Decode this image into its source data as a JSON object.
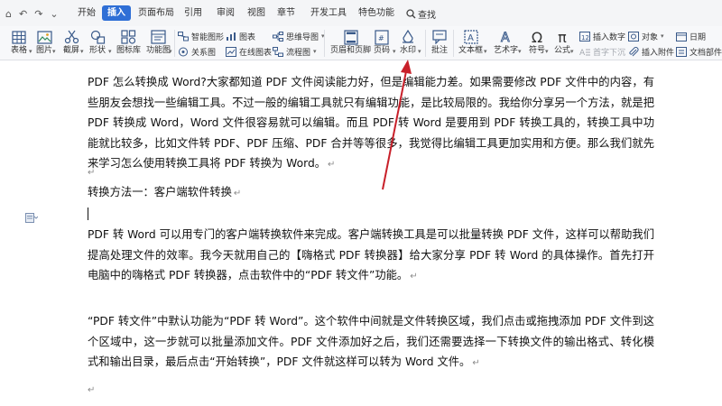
{
  "menu": {
    "quick_access": [
      "⌂",
      "↶",
      "↷",
      "⌄"
    ],
    "tabs": [
      {
        "label": "开始"
      },
      {
        "label": "插入"
      },
      {
        "label": "页面布局"
      },
      {
        "label": "引用"
      },
      {
        "label": "审阅"
      },
      {
        "label": "视图"
      },
      {
        "label": "章节"
      },
      {
        "label": "开发工具"
      },
      {
        "label": "特色功能"
      }
    ],
    "search_label": "查找"
  },
  "ribbon": {
    "table": "表格",
    "picture": "图片",
    "screenshot": "截屏",
    "shape": "形状",
    "icon_library": "图标库",
    "function_chart": "功能图",
    "smart_graphic": "智能图形",
    "chart": "图表",
    "mind_map": "思维导图",
    "relation_chart": "关系图",
    "online_chart": "在线图表",
    "flow_chart": "流程图",
    "header_footer": "页眉和页脚",
    "page_number": "页码",
    "watermark": "水印",
    "comment": "批注",
    "text_box": "文本框",
    "word_art": "艺术字",
    "symbol": "符号",
    "formula": "公式",
    "insert_number": "插入数字",
    "object": "对象",
    "date": "日期",
    "drop_cap": "首字下沉",
    "attachment": "插入附件",
    "doc_part": "文档部件"
  },
  "document": {
    "p1": "PDF 怎么转换成 Word?大家都知道 PDF 文件阅读能力好，但是编辑能力差。如果需要修改 PDF 文件中的内容，有些朋友会想找一些编辑工具。不过一般的编辑工具就只有编辑功能，是比较局限的。我给你分享另一个方法，就是把 PDF 转换成 Word，Word 文件很容易就可以编辑。而且 PDF 转 Word 是要用到 PDF 转换工具的，转换工具中功能就比较多，比如文件转 PDF、PDF 压缩、PDF 合并等等很多，我觉得比编辑工具更加实用和方便。那么我们就先来学习怎么使用转换工具将 PDF 转换为 Word。",
    "heading": "转换方法一：客户端软件转换",
    "p2": "PDF 转 Word 可以用专门的客户端转换软件来完成。客户端转换工具是可以批量转换 PDF 文件，这样可以帮助我们提高处理文件的效率。我今天就用自己的【嗨格式 PDF 转换器】给大家分享 PDF 转 Word 的具体操作。首先打开电脑中的嗨格式 PDF 转换器，点击软件中的“PDF 转文件”功能。",
    "p3": "“PDF 转文件”中默认功能为“PDF 转 Word”。这个软件中间就是文件转换区域，我们点击或拖拽添加 PDF 文件到这个区域中，这一步就可以批量添加文件。PDF 文件添加好之后，我们还需要选择一下转换文件的输出格式、转化模式和输出目录，最后点击“开始转换”，PDF 文件就这样可以转为 Word 文件。",
    "paragraph_mark": "↵"
  },
  "colors": {
    "accent": "#2f6fd6",
    "arrow": "#c8202a"
  }
}
